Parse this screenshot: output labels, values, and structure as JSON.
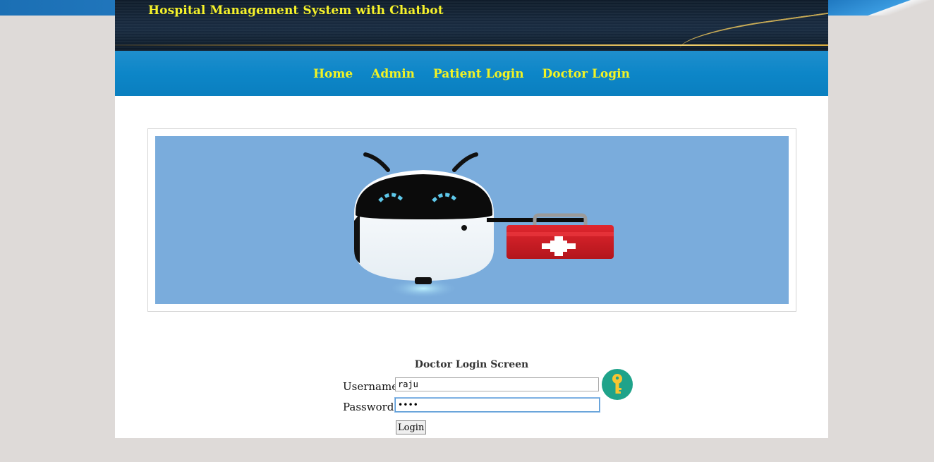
{
  "header": {
    "title": "Hospital Management System with Chatbot"
  },
  "nav": {
    "items": [
      "Home",
      "Admin",
      "Patient Login",
      "Doctor Login"
    ]
  },
  "banner": {
    "image": "chatbot-robot-with-first-aid-kit"
  },
  "login": {
    "title": "Doctor Login Screen",
    "username_label": "Username",
    "username_value": "raju",
    "password_label": "Password",
    "password_value": "••••",
    "button_label": "Login"
  },
  "colors": {
    "title_yellow": "#f6f22a",
    "nav_blue": "#0d86c8",
    "banner_blue": "#7aacdc",
    "key_teal": "#1fa38a",
    "key_yellow": "#f7c531"
  },
  "icons": {
    "login_icon": "key-icon"
  }
}
